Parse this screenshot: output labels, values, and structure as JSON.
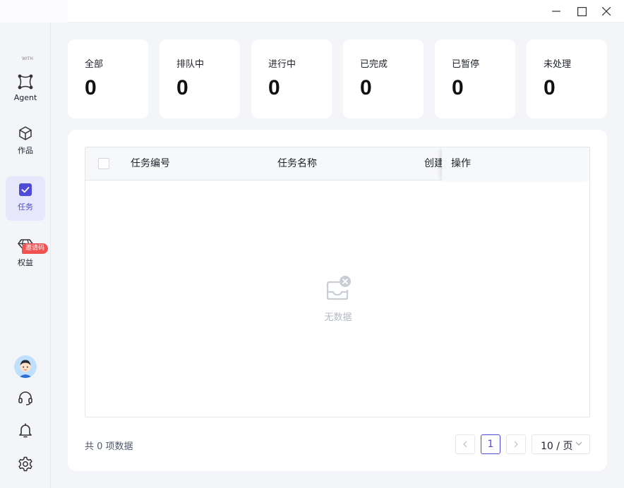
{
  "window": {
    "minimize_icon": "minimize-icon",
    "maximize_icon": "maximize-icon",
    "close_icon": "close-icon"
  },
  "sidebar": {
    "logo_text": "WITH",
    "items": [
      {
        "label": "Agent",
        "icon": "agent-nodes-icon",
        "active": false
      },
      {
        "label": "作品",
        "icon": "cube-icon",
        "active": false
      },
      {
        "label": "任务",
        "icon": "checkbox-icon",
        "active": true
      },
      {
        "label": "权益",
        "icon": "diamond-icon",
        "active": false,
        "badge": "邀请码"
      }
    ],
    "bottom_icons": [
      "avatar",
      "headset-icon",
      "bell-icon",
      "gear-icon"
    ]
  },
  "stats": [
    {
      "label": "全部",
      "value": "0"
    },
    {
      "label": "排队中",
      "value": "0"
    },
    {
      "label": "进行中",
      "value": "0"
    },
    {
      "label": "已完成",
      "value": "0"
    },
    {
      "label": "已暂停",
      "value": "0"
    },
    {
      "label": "未处理",
      "value": "0"
    }
  ],
  "table": {
    "columns": [
      "任务编号",
      "任务名称",
      "创建",
      "操作"
    ],
    "empty_text": "无数据",
    "rows": []
  },
  "pagination": {
    "total_text": "共 0 项数据",
    "current_page": "1",
    "page_size": "10 / 页"
  },
  "colors": {
    "accent": "#4e4bd8",
    "badge": "#f05252",
    "background": "#f4f5f9"
  }
}
